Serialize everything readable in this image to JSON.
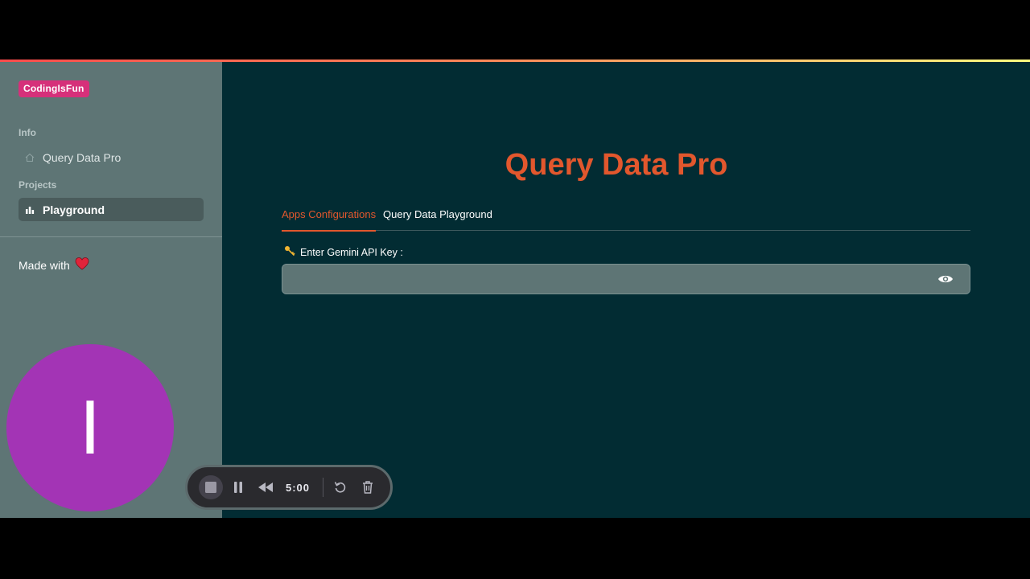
{
  "sidebar": {
    "brand": "CodingIsFun",
    "sections": [
      {
        "label": "Info",
        "items": [
          {
            "label": "Query Data Pro",
            "icon": "home-icon"
          }
        ]
      },
      {
        "label": "Projects",
        "items": [
          {
            "label": "Playground",
            "icon": "bar-chart-icon"
          }
        ]
      }
    ],
    "made_with": "Made with"
  },
  "main": {
    "title": "Query Data Pro",
    "tabs": [
      {
        "label": "Apps Configurations",
        "active": true
      },
      {
        "label": "Query Data Playground",
        "active": false
      }
    ],
    "api_key_label": "Enter Gemini API Key :",
    "api_key_value": ""
  },
  "overlay": {
    "avatar_letter": "I",
    "recorder_time": "5:00"
  },
  "colors": {
    "accent": "#e2572d",
    "brand": "#d6307a",
    "main_bg": "#022c33",
    "sidebar_bg": "#5e7575",
    "avatar": "#a334b5"
  }
}
